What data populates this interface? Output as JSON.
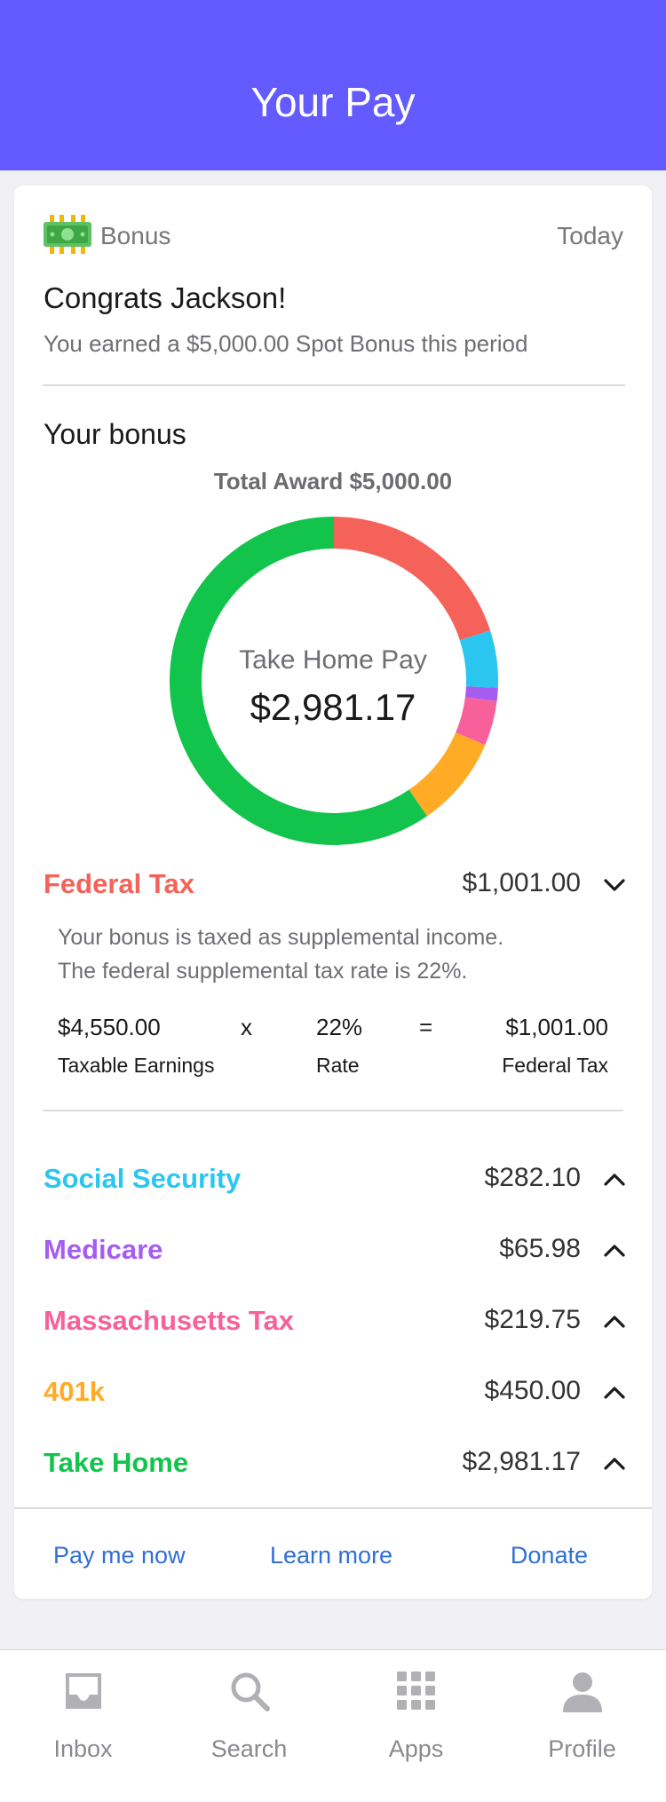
{
  "header": {
    "title": "Your Pay"
  },
  "card": {
    "category": "Bonus",
    "date": "Today",
    "greeting": "Congrats Jackson!",
    "message": "You earned a $5,000.00 Spot Bonus this period",
    "section_title": "Your bonus",
    "total_award": "Total Award $5,000.00",
    "donut": {
      "title": "Take Home Pay",
      "value": "$2,981.17"
    },
    "breakdown": [
      {
        "label": "Federal Tax",
        "amount": "$1,001.00",
        "value": 1001.0,
        "color": "#f5625a",
        "chevron": "chevron-down-icon"
      },
      {
        "label": "Social Security",
        "amount": "$282.10",
        "value": 282.1,
        "color": "#2bc6f0",
        "chevron": "chevron-up-icon"
      },
      {
        "label": "Medicare",
        "amount": "$65.98",
        "value": 65.98,
        "color": "#a65cf0",
        "chevron": "chevron-up-icon"
      },
      {
        "label": "Massachusetts Tax",
        "amount": "$219.75",
        "value": 219.75,
        "color": "#f7609a",
        "chevron": "chevron-up-icon"
      },
      {
        "label": "401k",
        "amount": "$450.00",
        "value": 450.0,
        "color": "#ffab26",
        "chevron": "chevron-up-icon"
      },
      {
        "label": "Take Home",
        "amount": "$2,981.17",
        "value": 2981.17,
        "color": "#12c44c",
        "chevron": "chevron-up-icon"
      }
    ],
    "federal_detail": {
      "line1": "Your bonus is taxed as supplemental income.",
      "line2": "The federal supplemental tax rate is 22%.",
      "taxable_value": "$4,550.00",
      "taxable_label": "Taxable Earnings",
      "times": "x",
      "rate_value": "22%",
      "rate_label": "Rate",
      "equals": "=",
      "result_value": "$1,001.00",
      "result_label": "Federal Tax"
    },
    "actions": {
      "pay_now": "Pay me now",
      "learn_more": "Learn more",
      "donate": "Donate"
    },
    "action_color": "#2f6fd6"
  },
  "tabbar": [
    {
      "label": "Inbox",
      "icon": "inbox-icon"
    },
    {
      "label": "Search",
      "icon": "search-icon"
    },
    {
      "label": "Apps",
      "icon": "apps-grid-icon"
    },
    {
      "label": "Profile",
      "icon": "profile-icon"
    }
  ],
  "colors": {
    "header": "#635bff",
    "background": "#f0f0f5",
    "tab_inactive": "#b0b0b5"
  }
}
